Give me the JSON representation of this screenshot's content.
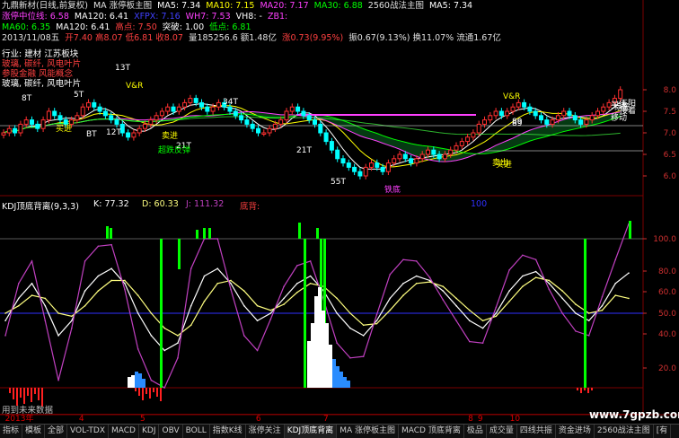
{
  "header": {
    "line1": [
      {
        "text": "九鼎新材(日线,前复权)",
        "color": "#e0e0e0"
      },
      {
        "text": "MA 涨停板主图",
        "color": "#e0e0e0"
      },
      {
        "text": "MA5: 7.34",
        "color": "#ffffff"
      },
      {
        "text": "MA10: 7.15",
        "color": "#ffff00"
      },
      {
        "text": "MA20: 7.17",
        "color": "#ff40ff"
      },
      {
        "text": "MA30: 6.88",
        "color": "#00ff00"
      },
      {
        "text": "2560战法主图",
        "color": "#e0e0e0"
      },
      {
        "text": "MA5: 7.34",
        "color": "#ffffff"
      }
    ],
    "line2": [
      {
        "text": "涨停中位线: 6.58",
        "color": "#ff40ff"
      },
      {
        "text": "MA120: 6.41",
        "color": "#ffffff"
      },
      {
        "text": "XFPX: 7.16",
        "color": "#4040ff"
      },
      {
        "text": "WH7: 7.53",
        "color": "#ff40ff"
      },
      {
        "text": "VH8: -",
        "color": "#ffffff"
      },
      {
        "text": "ZB1:",
        "color": "#ff40ff"
      }
    ],
    "line3": [
      {
        "text": "MA60: 6.35",
        "color": "#00ff00"
      },
      {
        "text": "MA120: 6.41",
        "color": "#ffffff"
      },
      {
        "text": "高点: 7.50",
        "color": "#ff4040"
      },
      {
        "text": "突破: 1.00",
        "color": "#ffffff"
      },
      {
        "text": "低点: 6.81",
        "color": "#00ff00"
      }
    ],
    "line4": [
      {
        "text": "2013/11/08五",
        "color": "#e0e0e0"
      },
      {
        "text": "开7.40 高8.07 低6.81 收8.07",
        "color": "#ff4040"
      },
      {
        "text": "量185256.6 额1.48亿",
        "color": "#e0e0e0"
      },
      {
        "text": "涨0.73(9.95%)",
        "color": "#ff4040"
      },
      {
        "text": "振0.67(9.13%) 换11.07% 流通1.67亿",
        "color": "#e0e0e0"
      }
    ]
  },
  "annotations": {
    "industry": "行业: 建材  江苏板块",
    "concepts1": "玻璃, 碳纤, 风电叶片",
    "concepts2": "参股金融 风能概念",
    "concepts3": "玻璃, 碳纤, 风电叶片",
    "labels": [
      "13T",
      "5T",
      "8T",
      "34T",
      "BT",
      "买进",
      "12T",
      "卖进",
      "21T",
      "超跌反弹",
      "21T",
      "V&R",
      "55T",
      "铁底",
      "V&R",
      "买进",
      "89",
      "卖出",
      "买进",
      "89",
      "玉阳",
      "标签",
      "接着",
      "移动"
    ]
  },
  "price_axis": [
    "8.0",
    "7.5",
    "7.0",
    "6.5",
    "6.0"
  ],
  "indicator": {
    "title": "KDJ顶底背离(9,3,3)",
    "k": "K: 77.32",
    "d": "D: 60.33",
    "j": "J: 111.32",
    "extra": "底背:",
    "extra2": "100",
    "axis": [
      "100.0",
      "80.0",
      "60.0",
      "50.0",
      "40.0",
      "20.0"
    ]
  },
  "footer_note": "用到未来数据",
  "time_axis": [
    {
      "text": "2013年",
      "pos": 0.005
    },
    {
      "text": "4",
      "pos": 0.12
    },
    {
      "text": "5",
      "pos": 0.215
    },
    {
      "text": "6",
      "pos": 0.395
    },
    {
      "text": "7",
      "pos": 0.5
    },
    {
      "text": "8",
      "pos": 0.725
    },
    {
      "text": "9",
      "pos": 0.74
    },
    {
      "text": "10",
      "pos": 0.79
    }
  ],
  "tabs": [
    "指标",
    "模板",
    "全部",
    "VOL-TDX",
    "MACD",
    "KDJ",
    "OBV",
    "BOLL",
    "指数K线",
    "涨停关注",
    "KDJ顶底背离",
    "MA 涨停板主图",
    "MACD 顶底背离",
    "极品",
    "成交量",
    "四线共振",
    "资金进场",
    "2560战法主图",
    "[有"
  ],
  "active_tab": "KDJ顶底背离",
  "watermark": "www.7gpzb.com",
  "colors": {
    "up": "#ff3030",
    "down": "#00ffff",
    "k": "#ffffff",
    "d": "#ffff80",
    "j": "#c040c0",
    "grid": "#7a0000"
  },
  "chart_data": {
    "type": "line",
    "title": "KDJ顶底背离(9,3,3)",
    "ylim": [
      0,
      100
    ],
    "series": [
      {
        "name": "K",
        "values": [
          45,
          60,
          70,
          55,
          35,
          45,
          65,
          75,
          80,
          70,
          50,
          35,
          25,
          30,
          55,
          75,
          80,
          70,
          55,
          45,
          50,
          60,
          70,
          75,
          65,
          50,
          40,
          35,
          45,
          60,
          70,
          75,
          72,
          65,
          55,
          45,
          40,
          50,
          65,
          75,
          78,
          70,
          60,
          50,
          45,
          55,
          70,
          77
        ]
      },
      {
        "name": "D",
        "values": [
          50,
          55,
          62,
          60,
          50,
          48,
          55,
          65,
          72,
          72,
          62,
          50,
          40,
          35,
          42,
          58,
          70,
          72,
          65,
          55,
          52,
          56,
          64,
          70,
          68,
          60,
          50,
          42,
          43,
          52,
          62,
          70,
          71,
          68,
          60,
          52,
          45,
          48,
          58,
          68,
          74,
          72,
          65,
          56,
          50,
          52,
          62,
          60
        ]
      },
      {
        "name": "J",
        "values": [
          35,
          70,
          85,
          45,
          5,
          40,
          85,
          95,
          96,
          66,
          26,
          5,
          0,
          20,
          80,
          100,
          100,
          66,
          35,
          25,
          46,
          68,
          82,
          85,
          59,
          30,
          20,
          21,
          49,
          76,
          86,
          85,
          74,
          59,
          45,
          31,
          30,
          54,
          79,
          89,
          86,
          66,
          50,
          38,
          35,
          61,
          86,
          111
        ]
      }
    ]
  }
}
